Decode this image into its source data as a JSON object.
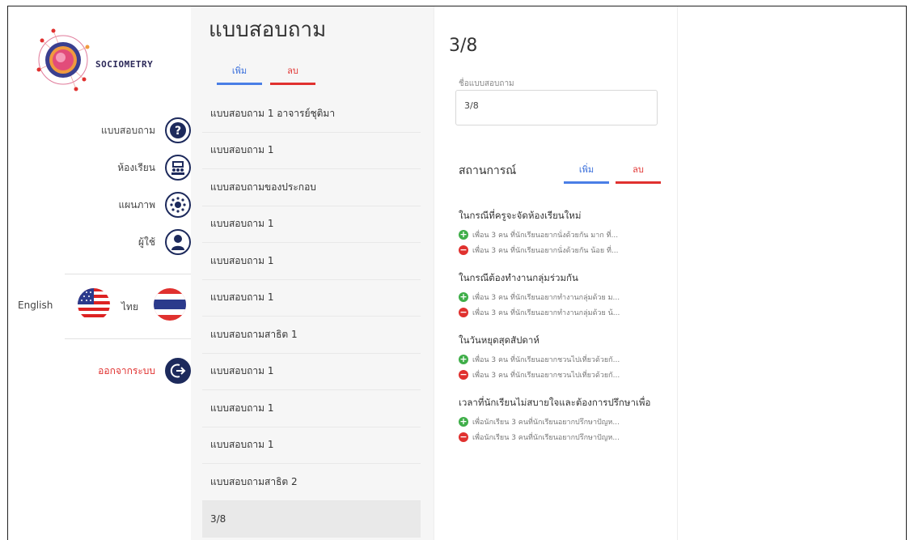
{
  "app": {
    "brand": "SOCIOMETRY"
  },
  "sidebar": {
    "items": [
      {
        "label": "แบบสอบถาม",
        "icon": "question-icon"
      },
      {
        "label": "ห้องเรียน",
        "icon": "classroom-icon"
      },
      {
        "label": "แผนภาพ",
        "icon": "network-icon"
      },
      {
        "label": "ผู้ใช้",
        "icon": "user-icon"
      }
    ],
    "languages": {
      "english": "English",
      "thai": "ไทย"
    },
    "logout": "ออกจากระบบ"
  },
  "list": {
    "title": "แบบสอบถาม",
    "add_label": "เพิ่ม",
    "delete_label": "ลบ",
    "items": [
      "แบบสอบถาม 1 อาจารย์ชุติมา",
      "แบบสอบถาม 1",
      "แบบสอบถามของประกอบ",
      "แบบสอบถาม 1",
      "แบบสอบถาม 1",
      "แบบสอบถาม 1",
      "แบบสอบถามสาธิต 1",
      "แบบสอบถาม 1",
      "แบบสอบถาม 1",
      "แบบสอบถาม 1",
      "แบบสอบถามสาธิต 2",
      "3/8"
    ]
  },
  "detail": {
    "title": "3/8",
    "name_label": "ชื่อแบบสอบถาม",
    "name_value": "3/8",
    "situations_title": "สถานการณ์",
    "add_label": "เพิ่ม",
    "delete_label": "ลบ",
    "situations": [
      {
        "title": "ในกรณีที่ครูจะจัดห้องเรียนใหม่",
        "positive": "เพื่อน 3 คน ที่นักเรียนอยากนั่งด้วยกัน มาก ที่...",
        "negative": "เพื่อน 3 คน ที่นักเรียนอยากนั่งด้วยกัน น้อย ที่..."
      },
      {
        "title": "ในกรณีต้องทำงานกลุ่มร่วมกัน",
        "positive": "เพื่อน 3 คน ที่นักเรียนอยากทำงานกลุ่มด้วย ม...",
        "negative": "เพื่อน 3 คน ที่นักเรียนอยากทำงานกลุ่มด้วย น้..."
      },
      {
        "title": "ในวันหยุดสุดสัปดาห์",
        "positive": "เพื่อน 3 คน ที่นักเรียนอยากชวนไปเที่ยวด้วยกั...",
        "negative": "เพื่อน 3 คน ที่นักเรียนอยากชวนไปเที่ยวด้วยกั..."
      },
      {
        "title": "เวลาที่นักเรียนไม่สบายใจและต้องการปรึกษาเพื่อ",
        "positive": "เพื่อนักเรียน 3 คนที่นักเรียนอยากปรึกษาปัญห...",
        "negative": "เพื่อนักเรียน 3 คนที่นักเรียนอยากปรึกษาปัญห..."
      }
    ]
  },
  "colors": {
    "accent_blue": "#4a7ee6",
    "danger_red": "#e0312f",
    "success_green": "#3fae49",
    "navy": "#1d2a5c"
  }
}
